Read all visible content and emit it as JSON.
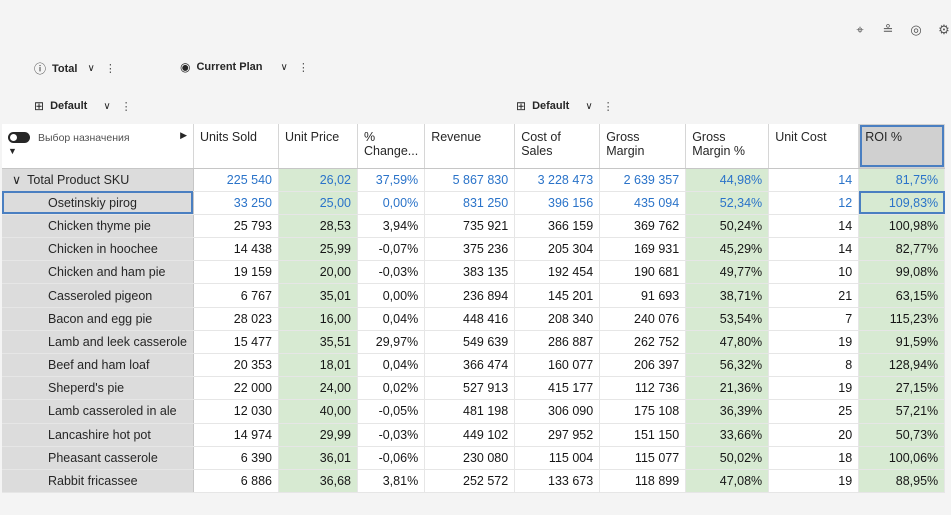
{
  "toolbar_icons": [
    "pin-icon",
    "format-icon",
    "view-icon",
    "settings-icon"
  ],
  "filters": {
    "total": {
      "label": "Total",
      "icon": "info-circle-icon"
    },
    "plan": {
      "label": "Current Plan",
      "icon": "radio-icon"
    },
    "rows_default": {
      "label": "Default"
    },
    "cols_default": {
      "label": "Default"
    }
  },
  "table": {
    "toggle_label": "Выбор назначения",
    "columns": [
      "Units Sold",
      "Unit Price",
      "% Change...",
      "Revenue",
      "Cost of Sales",
      "Gross Margin",
      "Gross Margin %",
      "Unit Cost",
      "ROI %"
    ],
    "total_row": {
      "label": "Total Product SKU",
      "values": [
        "225 540",
        "26,02",
        "37,59%",
        "5 867 830",
        "3 228 473",
        "2 639 357",
        "44,98%",
        "14",
        "81,75%"
      ]
    },
    "rows": [
      {
        "label": "Osetinskiy pirog",
        "values": [
          "33 250",
          "25,00",
          "0,00%",
          "831 250",
          "396 156",
          "435 094",
          "52,34%",
          "12",
          "109,83%"
        ]
      },
      {
        "label": "Chicken thyme pie",
        "values": [
          "25 793",
          "28,53",
          "3,94%",
          "735 921",
          "366 159",
          "369 762",
          "50,24%",
          "14",
          "100,98%"
        ]
      },
      {
        "label": "Chicken in hoochee",
        "values": [
          "14 438",
          "25,99",
          "-0,07%",
          "375 236",
          "205 304",
          "169 931",
          "45,29%",
          "14",
          "82,77%"
        ]
      },
      {
        "label": "Chicken and ham pie",
        "values": [
          "19 159",
          "20,00",
          "-0,03%",
          "383 135",
          "192 454",
          "190 681",
          "49,77%",
          "10",
          "99,08%"
        ]
      },
      {
        "label": "Casseroled pigeon",
        "values": [
          "6 767",
          "35,01",
          "0,00%",
          "236 894",
          "145 201",
          "91 693",
          "38,71%",
          "21",
          "63,15%"
        ]
      },
      {
        "label": "Bacon and egg pie",
        "values": [
          "28 023",
          "16,00",
          "0,04%",
          "448 416",
          "208 340",
          "240 076",
          "53,54%",
          "7",
          "115,23%"
        ]
      },
      {
        "label": "Lamb and leek casserole",
        "values": [
          "15 477",
          "35,51",
          "29,97%",
          "549 639",
          "286 887",
          "262 752",
          "47,80%",
          "19",
          "91,59%"
        ]
      },
      {
        "label": "Beef and ham loaf",
        "values": [
          "20 353",
          "18,01",
          "0,04%",
          "366 474",
          "160 077",
          "206 397",
          "56,32%",
          "8",
          "128,94%"
        ]
      },
      {
        "label": "Sheperd's pie",
        "values": [
          "22 000",
          "24,00",
          "0,02%",
          "527 913",
          "415 177",
          "112 736",
          "21,36%",
          "19",
          "27,15%"
        ]
      },
      {
        "label": "Lamb casseroled in ale",
        "values": [
          "12 030",
          "40,00",
          "-0,05%",
          "481 198",
          "306 090",
          "175 108",
          "36,39%",
          "25",
          "57,21%"
        ]
      },
      {
        "label": "Lancashire hot pot",
        "values": [
          "14 974",
          "29,99",
          "-0,03%",
          "449 102",
          "297 952",
          "151 150",
          "33,66%",
          "20",
          "50,73%"
        ]
      },
      {
        "label": "Pheasant casserole",
        "values": [
          "6 390",
          "36,01",
          "-0,06%",
          "230 080",
          "115 004",
          "115 077",
          "50,02%",
          "18",
          "100,06%"
        ]
      },
      {
        "label": "Rabbit fricassee",
        "values": [
          "6 886",
          "36,68",
          "3,81%",
          "252 572",
          "133 673",
          "118 899",
          "47,08%",
          "19",
          "88,95%"
        ]
      }
    ]
  }
}
